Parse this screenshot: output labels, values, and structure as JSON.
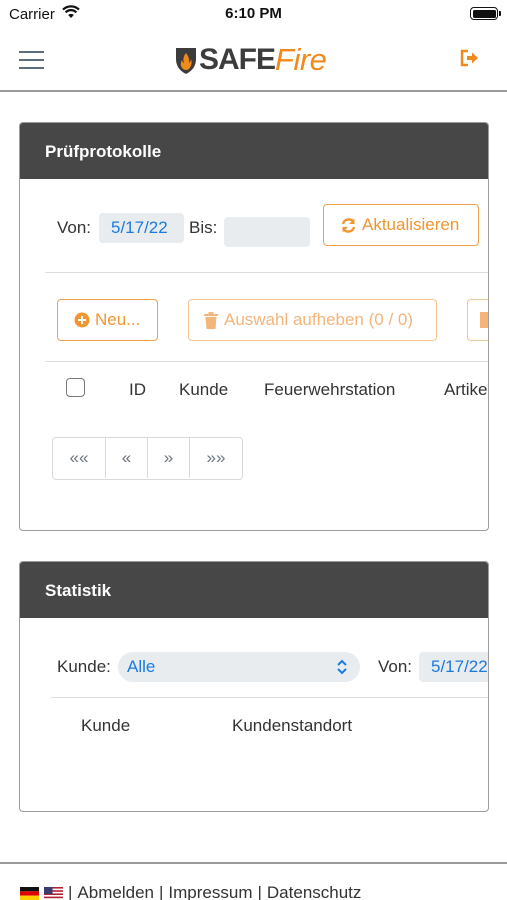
{
  "statusbar": {
    "carrier": "Carrier",
    "time": "6:10 PM"
  },
  "header": {
    "logo_safe": "SAFE",
    "logo_fire": "Fire"
  },
  "pruef": {
    "title": "Prüfprotokolle",
    "von_label": "Von:",
    "von_value": "5/17/22",
    "bis_label": "Bis:",
    "bis_value": "",
    "refresh_label": "Aktualisieren",
    "new_label": "Neu...",
    "clear_label": "Auswahl aufheben (0 / 0)",
    "columns": [
      "ID",
      "Kunde",
      "Feuerwehrstation",
      "Artikel"
    ],
    "pager": [
      "««",
      "«",
      "»",
      "»»"
    ]
  },
  "stats": {
    "title": "Statistik",
    "kunde_label": "Kunde:",
    "kunde_value": "Alle",
    "von_label": "Von:",
    "von_value": "5/17/22",
    "columns": [
      "Kunde",
      "Kundenstandort"
    ]
  },
  "footer": {
    "abmelden": "Abmelden",
    "impressum": "Impressum",
    "datenschutz": "Datenschutz",
    "separator": "|"
  },
  "colors": {
    "accent": "#f08a1c",
    "card_header": "#474747",
    "link": "#1a7ae0"
  }
}
